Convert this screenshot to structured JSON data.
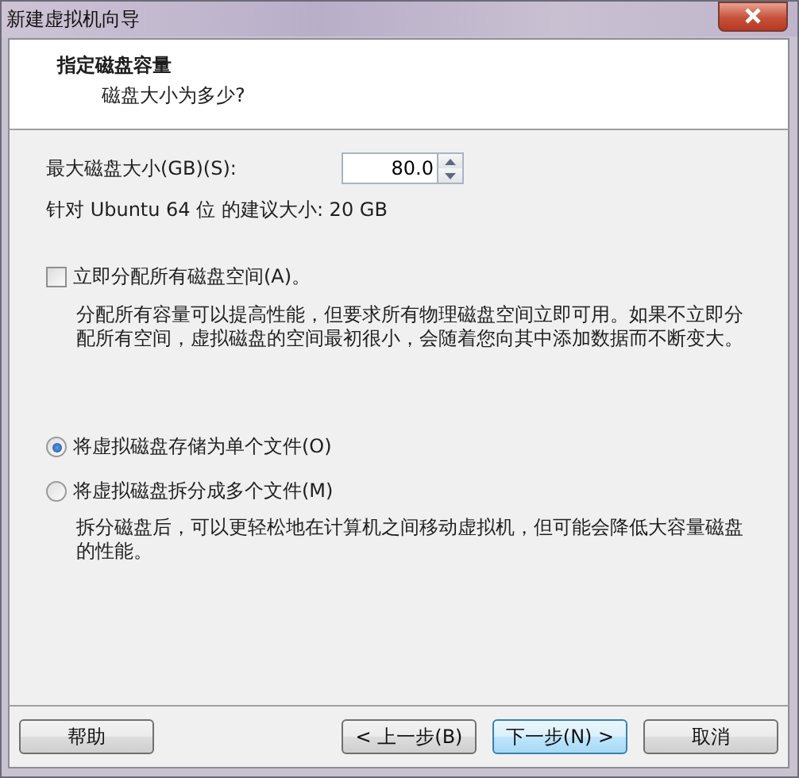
{
  "window": {
    "title": "新建虚拟机向导"
  },
  "header": {
    "title": "指定磁盘容量",
    "subtitle": "磁盘大小为多少?"
  },
  "disk_size": {
    "label": "最大磁盘大小(GB)(S):",
    "value": "80.0"
  },
  "recommendation": "针对 Ubuntu 64 位 的建议大小: 20 GB",
  "allocate": {
    "label": "立即分配所有磁盘空间(A)。",
    "checked": false,
    "description": "分配所有容量可以提高性能，但要求所有物理磁盘空间立即可用。如果不立即分配所有空间，虚拟磁盘的空间最初很小，会随着您向其中添加数据而不断变大。"
  },
  "storage_options": [
    {
      "label": "将虚拟磁盘存储为单个文件(O)",
      "selected": true
    },
    {
      "label": "将虚拟磁盘拆分成多个文件(M)",
      "selected": false,
      "description": "拆分磁盘后，可以更轻松地在计算机之间移动虚拟机，但可能会降低大容量磁盘的性能。"
    }
  ],
  "buttons": [
    {
      "label": "帮助",
      "default": false
    },
    {
      "label": "< 上一步(B)",
      "default": false
    },
    {
      "label": "下一步(N) >",
      "default": true
    },
    {
      "label": "取消",
      "default": false
    }
  ]
}
